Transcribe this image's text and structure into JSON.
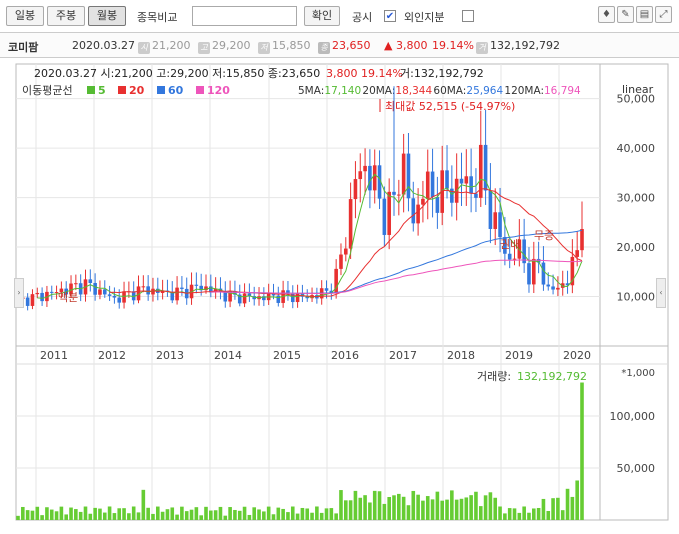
{
  "toolbar": {
    "daily": "일봉",
    "weekly": "주봉",
    "monthly": "월봉",
    "compare_label": "종목비교",
    "compare_placeholder": "",
    "confirm": "확인",
    "notice": "공시",
    "foreign": "외인지분"
  },
  "info": {
    "name": "코미팜",
    "date": "2020.03.27",
    "open": "21,200",
    "high": "29,200",
    "low": "15,850",
    "close": "23,650",
    "change": "▲ 3,800",
    "pct": "19.14%",
    "volume": "132,192,792",
    "icons": {
      "open": "시",
      "high": "고",
      "low": "저",
      "close": "종",
      "volume": "거"
    }
  },
  "chart_data": {
    "type": "candlestick",
    "title": "",
    "header": {
      "date": "2020.03.27",
      "open_label": "시:",
      "open": "21,200",
      "high_label": "고:",
      "high": "29,200",
      "low_label": "저:",
      "low": "15,850",
      "close_label": "종:",
      "close": "23,650",
      "change": "3,800",
      "pct": "19.14%",
      "vol_label": "거:",
      "volume": "132,192,792"
    },
    "ma_legend": {
      "title": "이동평균선",
      "items": [
        {
          "label": "5",
          "color": "#55bb33"
        },
        {
          "label": "20",
          "color": "#e83030"
        },
        {
          "label": "60",
          "color": "#3377dd"
        },
        {
          "label": "120",
          "color": "#ee55bb"
        }
      ]
    },
    "ma_values": [
      {
        "label": "5MA:",
        "value": "17,140",
        "color": "#55bb33"
      },
      {
        "label": "20MA:",
        "value": "18,344",
        "color": "#e83030"
      },
      {
        "label": "60MA:",
        "value": "25,964",
        "color": "#3377dd"
      },
      {
        "label": "120MA:",
        "value": "16,794",
        "color": "#ee55bb"
      }
    ],
    "scale_label": "linear",
    "max_annotation": "최대값 52,515 (-54.97%)",
    "annotations": [
      "액분",
      "권배",
      "무증"
    ],
    "price_axis": {
      "ticks": [
        10000,
        20000,
        30000,
        40000,
        50000
      ],
      "tick_labels": [
        "10,000",
        "20,000",
        "30,000",
        "40,000",
        "50,000"
      ],
      "ylim": [
        0,
        57000
      ]
    },
    "x_ticks": [
      "2011",
      "2012",
      "2013",
      "2014",
      "2015",
      "2016",
      "2017",
      "2018",
      "2019",
      "2020"
    ],
    "volume_panel": {
      "label": "거래량:",
      "value": "132,192,792",
      "unit": "*1,000",
      "ticks": [
        50000,
        100000
      ],
      "tick_labels": [
        "50,000",
        "100,000"
      ],
      "ylim": [
        0,
        150000
      ]
    },
    "colors": {
      "up": "#e83030",
      "down": "#3377dd",
      "volume": "#66cc33",
      "grid": "#e6e6e6"
    }
  }
}
